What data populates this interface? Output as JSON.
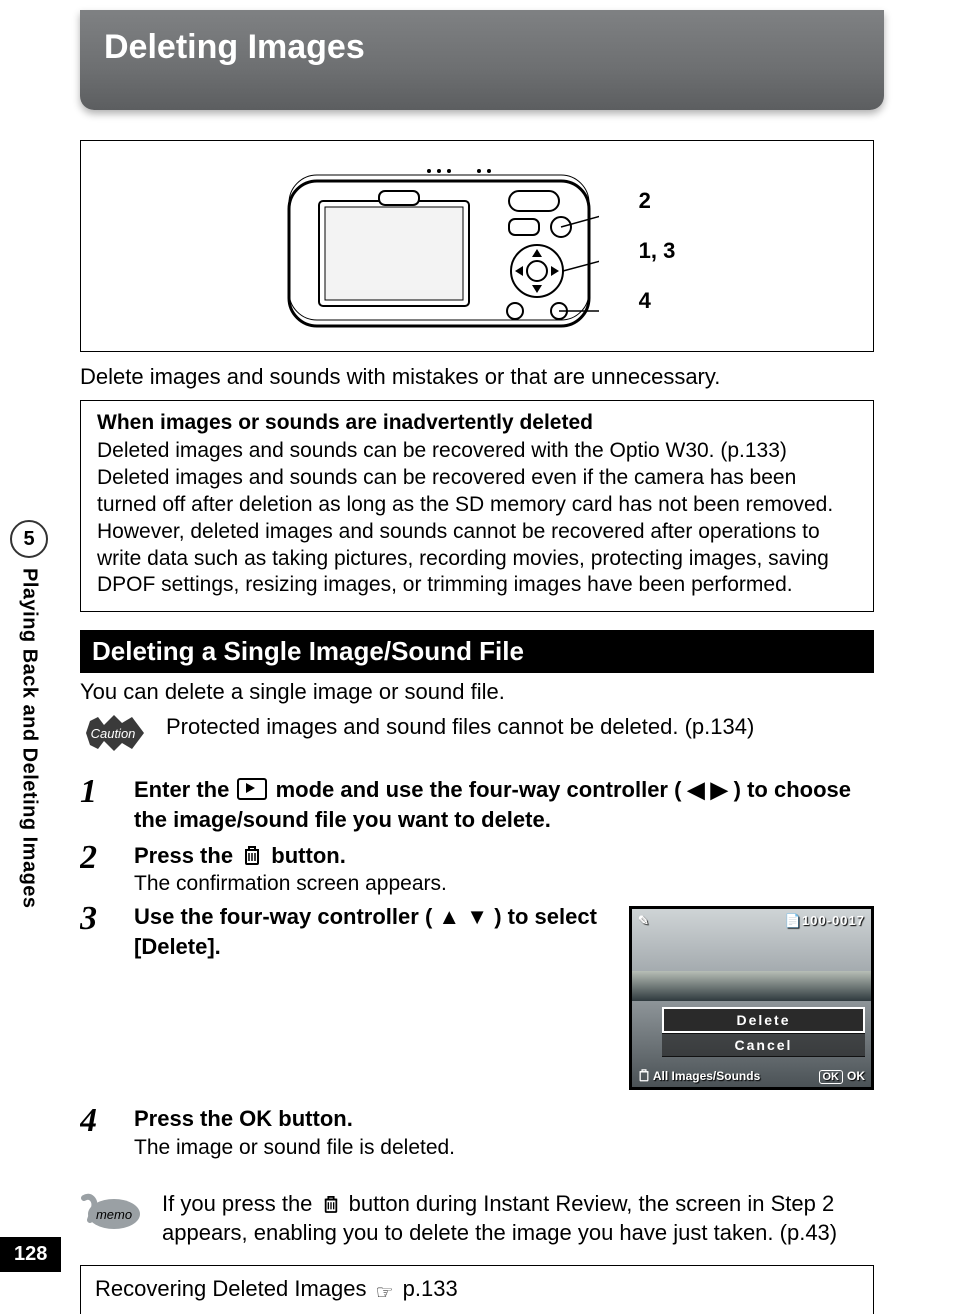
{
  "page_number": "128",
  "sidebar": {
    "chapter_number": "5",
    "chapter_title": "Playing Back and Deleting Images"
  },
  "title": "Deleting Images",
  "diagram": {
    "callouts": {
      "a": "2",
      "b": "1, 3",
      "c": "4"
    }
  },
  "intro": "Delete images and sounds with mistakes or that are unnecessary.",
  "recovery_note": {
    "heading": "When images or sounds are inadvertently deleted",
    "body": "Deleted images and sounds can be recovered with the Optio W30. (p.133) Deleted images and sounds can be recovered even if the camera has been turned off after deletion as long as the SD memory card has not been removed. However, deleted images and sounds cannot be recovered after operations to write data such as taking pictures, recording movies, protecting images, saving DPOF settings, resizing images, or trimming images have been performed."
  },
  "section": {
    "heading": "Deleting a Single Image/Sound File",
    "intro": "You can delete a single image or sound file.",
    "caution": "Protected images and sound files cannot be deleted. (p.134)",
    "steps": [
      {
        "num": "1",
        "title_pre": "Enter the ",
        "title_mid": " mode and use the four-way controller (",
        "title_arrows": "◀ ▶",
        "title_post": ") to choose the image/sound file you want to delete."
      },
      {
        "num": "2",
        "title_pre": "Press the ",
        "title_post": " button.",
        "sub": "The confirmation screen appears."
      },
      {
        "num": "3",
        "title_pre": "Use the four-way controller (",
        "title_arrows": "▲ ▼",
        "title_post": ") to select [Delete]."
      },
      {
        "num": "4",
        "title_pre": "Press the ",
        "ok_label": "OK",
        "title_post": " button.",
        "sub": "The image or sound file is deleted."
      }
    ],
    "lcd": {
      "file_number": "100-0017",
      "option_delete": "Delete",
      "option_cancel": "Cancel",
      "bottom_left": "All Images/Sounds",
      "bottom_ok_badge": "OK",
      "bottom_ok_text": "OK"
    },
    "memo_pre": "If you press the ",
    "memo_post": " button during Instant Review, the screen in Step 2 appears, enabling you to delete the image you have just taken. (p.43)",
    "xref_pre": "Recovering Deleted Images ",
    "xref_page": "p.133"
  },
  "glyphs": {
    "hand_pointer": "☞",
    "edit_icon_alt": "✎"
  }
}
